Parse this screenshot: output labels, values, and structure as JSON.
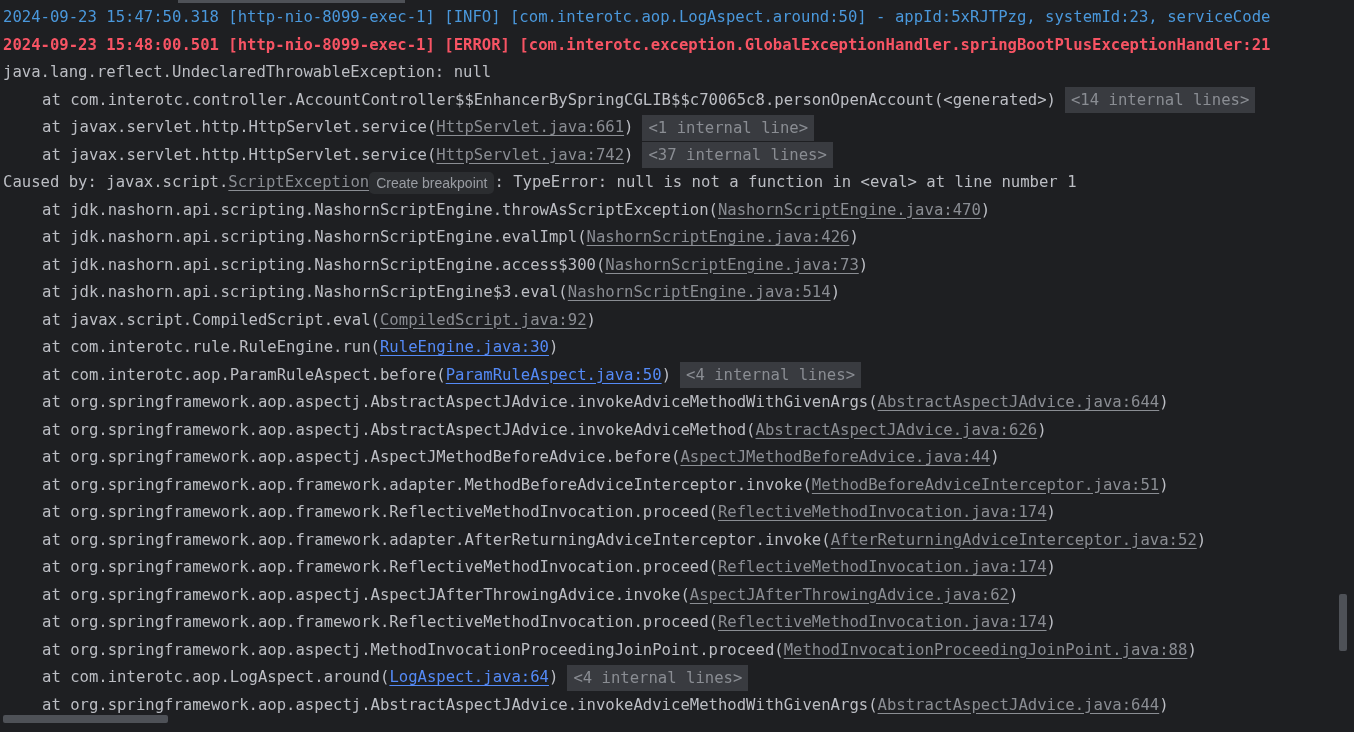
{
  "lines": [
    {
      "kind": "info",
      "parts": [
        {
          "kind": "text",
          "text": "2024-09-23 15:47:50.318 [http-nio-8099-exec-1] [INFO] [com.interotc.aop.LogAspect.around:50] - appId:5xRJTPzg, systemId:23, serviceCode"
        }
      ]
    },
    {
      "kind": "error",
      "parts": [
        {
          "kind": "text",
          "text": "2024-09-23 15:48:00.501 [http-nio-8099-exec-1] [ERROR] [com.interotc.exception.GlobalExceptionHandler.springBootPlusExceptionHandler:21"
        }
      ]
    },
    {
      "kind": "plain",
      "parts": [
        {
          "kind": "text",
          "text": "java.lang.reflect.UndeclaredThrowableException: null"
        }
      ]
    },
    {
      "kind": "frame",
      "parts": [
        {
          "kind": "text",
          "text": "at com.interotc.controller.AccountController$$EnhancerBySpringCGLIB$$c70065c8.personOpenAccount(<generated>)"
        },
        {
          "kind": "fold",
          "text": "<14 internal lines>"
        }
      ]
    },
    {
      "kind": "frame",
      "parts": [
        {
          "kind": "text",
          "text": "at javax.servlet.http.HttpServlet.service("
        },
        {
          "kind": "link",
          "project": false,
          "text": "HttpServlet.java:661"
        },
        {
          "kind": "text",
          "text": ")"
        },
        {
          "kind": "fold",
          "text": "<1 internal line>"
        }
      ]
    },
    {
      "kind": "frame",
      "parts": [
        {
          "kind": "text",
          "text": "at javax.servlet.http.HttpServlet.service("
        },
        {
          "kind": "link",
          "project": false,
          "text": "HttpServlet.java:742"
        },
        {
          "kind": "text",
          "text": ")"
        },
        {
          "kind": "fold",
          "text": "<37 internal lines>"
        }
      ]
    },
    {
      "kind": "plain",
      "parts": [
        {
          "kind": "text",
          "text": "Caused by: javax.script."
        },
        {
          "kind": "link",
          "project": false,
          "text": "ScriptException"
        },
        {
          "kind": "hint",
          "text": "Create breakpoint"
        },
        {
          "kind": "text",
          "text": ": TypeError: null is not a function in <eval> at line number 1"
        }
      ]
    },
    {
      "kind": "frame",
      "parts": [
        {
          "kind": "text",
          "text": "at jdk.nashorn.api.scripting.NashornScriptEngine.throwAsScriptException("
        },
        {
          "kind": "link",
          "project": false,
          "text": "NashornScriptEngine.java:470"
        },
        {
          "kind": "text",
          "text": ")"
        }
      ]
    },
    {
      "kind": "frame",
      "parts": [
        {
          "kind": "text",
          "text": "at jdk.nashorn.api.scripting.NashornScriptEngine.evalImpl("
        },
        {
          "kind": "link",
          "project": false,
          "text": "NashornScriptEngine.java:426"
        },
        {
          "kind": "text",
          "text": ")"
        }
      ]
    },
    {
      "kind": "frame",
      "parts": [
        {
          "kind": "text",
          "text": "at jdk.nashorn.api.scripting.NashornScriptEngine.access$300("
        },
        {
          "kind": "link",
          "project": false,
          "text": "NashornScriptEngine.java:73"
        },
        {
          "kind": "text",
          "text": ")"
        }
      ]
    },
    {
      "kind": "frame",
      "parts": [
        {
          "kind": "text",
          "text": "at jdk.nashorn.api.scripting.NashornScriptEngine$3.eval("
        },
        {
          "kind": "link",
          "project": false,
          "text": "NashornScriptEngine.java:514"
        },
        {
          "kind": "text",
          "text": ")"
        }
      ]
    },
    {
      "kind": "frame",
      "parts": [
        {
          "kind": "text",
          "text": "at javax.script.CompiledScript.eval("
        },
        {
          "kind": "link",
          "project": false,
          "text": "CompiledScript.java:92"
        },
        {
          "kind": "text",
          "text": ")"
        }
      ]
    },
    {
      "kind": "frame",
      "parts": [
        {
          "kind": "text",
          "text": "at com.interotc.rule.RuleEngine.run("
        },
        {
          "kind": "link",
          "project": true,
          "text": "RuleEngine.java:30"
        },
        {
          "kind": "text",
          "text": ")"
        }
      ]
    },
    {
      "kind": "frame",
      "parts": [
        {
          "kind": "text",
          "text": "at com.interotc.aop.ParamRuleAspect.before("
        },
        {
          "kind": "link",
          "project": true,
          "text": "ParamRuleAspect.java:50"
        },
        {
          "kind": "text",
          "text": ")"
        },
        {
          "kind": "fold",
          "text": "<4 internal lines>"
        }
      ]
    },
    {
      "kind": "frame",
      "parts": [
        {
          "kind": "text",
          "text": "at org.springframework.aop.aspectj.AbstractAspectJAdvice.invokeAdviceMethodWithGivenArgs("
        },
        {
          "kind": "link",
          "project": false,
          "text": "AbstractAspectJAdvice.java:644"
        },
        {
          "kind": "text",
          "text": ")"
        }
      ]
    },
    {
      "kind": "frame",
      "parts": [
        {
          "kind": "text",
          "text": "at org.springframework.aop.aspectj.AbstractAspectJAdvice.invokeAdviceMethod("
        },
        {
          "kind": "link",
          "project": false,
          "text": "AbstractAspectJAdvice.java:626"
        },
        {
          "kind": "text",
          "text": ")"
        }
      ]
    },
    {
      "kind": "frame",
      "parts": [
        {
          "kind": "text",
          "text": "at org.springframework.aop.aspectj.AspectJMethodBeforeAdvice.before("
        },
        {
          "kind": "link",
          "project": false,
          "text": "AspectJMethodBeforeAdvice.java:44"
        },
        {
          "kind": "text",
          "text": ")"
        }
      ]
    },
    {
      "kind": "frame",
      "parts": [
        {
          "kind": "text",
          "text": "at org.springframework.aop.framework.adapter.MethodBeforeAdviceInterceptor.invoke("
        },
        {
          "kind": "link",
          "project": false,
          "text": "MethodBeforeAdviceInterceptor.java:51"
        },
        {
          "kind": "text",
          "text": ")"
        }
      ]
    },
    {
      "kind": "frame",
      "parts": [
        {
          "kind": "text",
          "text": "at org.springframework.aop.framework.ReflectiveMethodInvocation.proceed("
        },
        {
          "kind": "link",
          "project": false,
          "text": "ReflectiveMethodInvocation.java:174"
        },
        {
          "kind": "text",
          "text": ")"
        }
      ]
    },
    {
      "kind": "frame",
      "parts": [
        {
          "kind": "text",
          "text": "at org.springframework.aop.framework.adapter.AfterReturningAdviceInterceptor.invoke("
        },
        {
          "kind": "link",
          "project": false,
          "text": "AfterReturningAdviceInterceptor.java:52"
        },
        {
          "kind": "text",
          "text": ")"
        }
      ]
    },
    {
      "kind": "frame",
      "parts": [
        {
          "kind": "text",
          "text": "at org.springframework.aop.framework.ReflectiveMethodInvocation.proceed("
        },
        {
          "kind": "link",
          "project": false,
          "text": "ReflectiveMethodInvocation.java:174"
        },
        {
          "kind": "text",
          "text": ")"
        }
      ]
    },
    {
      "kind": "frame",
      "parts": [
        {
          "kind": "text",
          "text": "at org.springframework.aop.aspectj.AspectJAfterThrowingAdvice.invoke("
        },
        {
          "kind": "link",
          "project": false,
          "text": "AspectJAfterThrowingAdvice.java:62"
        },
        {
          "kind": "text",
          "text": ")"
        }
      ]
    },
    {
      "kind": "frame",
      "parts": [
        {
          "kind": "text",
          "text": "at org.springframework.aop.framework.ReflectiveMethodInvocation.proceed("
        },
        {
          "kind": "link",
          "project": false,
          "text": "ReflectiveMethodInvocation.java:174"
        },
        {
          "kind": "text",
          "text": ")"
        }
      ]
    },
    {
      "kind": "frame",
      "parts": [
        {
          "kind": "text",
          "text": "at org.springframework.aop.aspectj.MethodInvocationProceedingJoinPoint.proceed("
        },
        {
          "kind": "link",
          "project": false,
          "text": "MethodInvocationProceedingJoinPoint.java:88"
        },
        {
          "kind": "text",
          "text": ")"
        }
      ]
    },
    {
      "kind": "frame",
      "parts": [
        {
          "kind": "text",
          "text": "at com.interotc.aop.LogAspect.around("
        },
        {
          "kind": "link",
          "project": true,
          "text": "LogAspect.java:64"
        },
        {
          "kind": "text",
          "text": ")"
        },
        {
          "kind": "fold",
          "text": "<4 internal lines>"
        }
      ]
    },
    {
      "kind": "frame",
      "parts": [
        {
          "kind": "text",
          "text": "at org.springframework.aop.aspectj.AbstractAspectJAdvice.invokeAdviceMethodWithGivenArgs("
        },
        {
          "kind": "link",
          "project": false,
          "text": "AbstractAspectJAdvice.java:644"
        },
        {
          "kind": "text",
          "text": ")"
        }
      ]
    }
  ]
}
